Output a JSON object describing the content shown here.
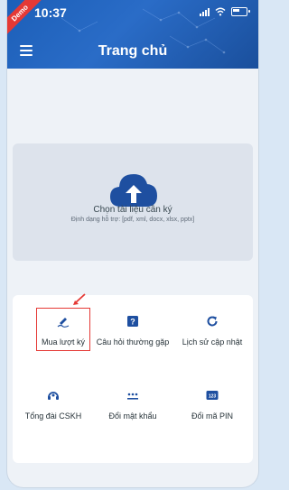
{
  "status_bar": {
    "time": "10:37",
    "demo_badge": "Demo"
  },
  "header": {
    "title": "Trang chủ"
  },
  "upload": {
    "label": "Chọn tài liệu cần ký",
    "hint": "Định dạng hỗ trợ: [pdf, xml, docx, xlsx, pptx]",
    "icon": "cloud-upload-icon"
  },
  "features": [
    {
      "label": "Mua lượt ký",
      "icon": "pen-sign-icon",
      "highlighted": true
    },
    {
      "label": "Câu hỏi thường gặp",
      "icon": "question-box-icon"
    },
    {
      "label": "Lịch sử cập nhật",
      "icon": "refresh-icon"
    },
    {
      "label": "Tổng đài CSKH",
      "icon": "headset-icon"
    },
    {
      "label": "Đổi mật khẩu",
      "icon": "password-icon"
    },
    {
      "label": "Đổi mã PIN",
      "icon": "pin-code-icon"
    }
  ],
  "colors": {
    "primary": "#1c5fb8",
    "accent_red": "#e53935",
    "icon_blue": "#1e4fa0"
  }
}
